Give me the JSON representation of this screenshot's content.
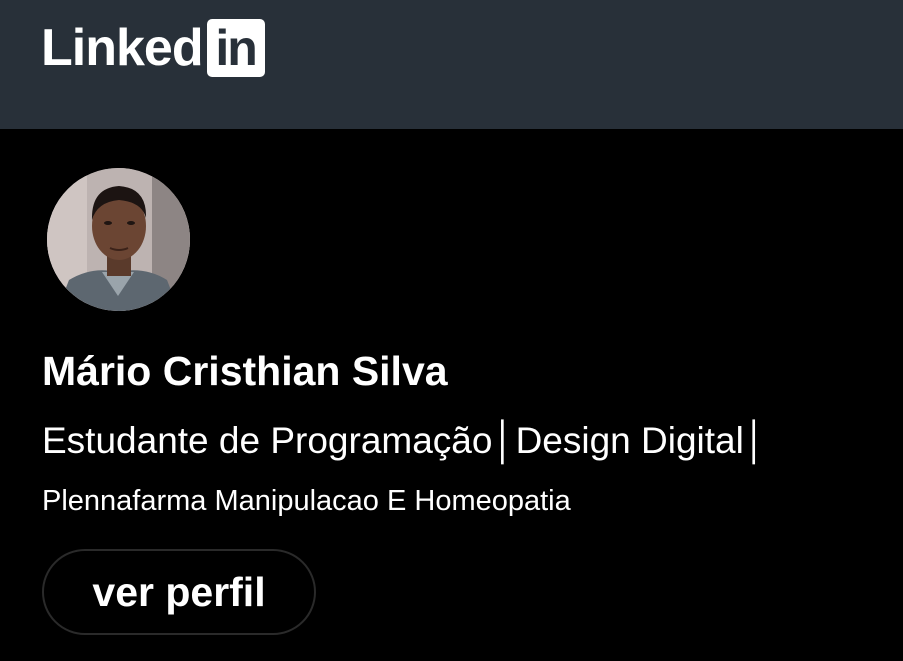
{
  "header": {
    "logo_word": "Linked",
    "logo_box": "in",
    "background": "#283039"
  },
  "profile": {
    "name": "Mário Cristhian Silva",
    "headline": "Estudante de Programação│Design Digital│",
    "company": "Plennafarma Manipulacao E Homeopatia",
    "view_button": "ver perfil"
  },
  "colors": {
    "card_background": "#000000",
    "text": "#ffffff"
  }
}
